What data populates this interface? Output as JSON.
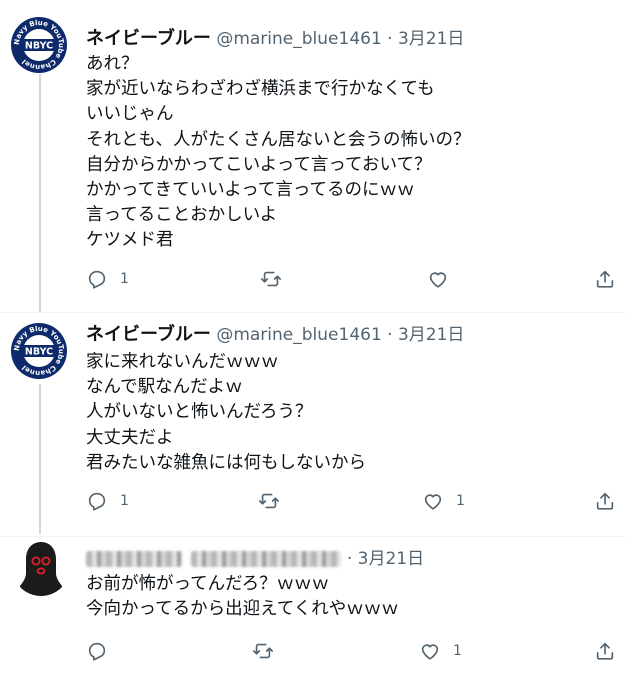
{
  "tweets": [
    {
      "name": "ネイビーブルー",
      "handle": "@marine_blue1461",
      "separator": "·",
      "date": "3月21日",
      "avatar": {
        "ring_text": "Navy Blue YouTube Channel",
        "center_text": "NBYC",
        "ring_color": "#0d2a6b"
      },
      "lines": [
        "あれ？",
        "家が近いならわざわざ横浜まで行かなくても",
        "いいじゃん",
        "それとも、人がたくさん居ないと会うの怖いの？",
        "自分からかかってこいよって言っておいて？",
        "かかってきていいよって言ってるのにｗｗ",
        "言ってることおかしいよ",
        "ケツメド君"
      ],
      "actions": {
        "reply_count": "1",
        "retweet_count": "",
        "like_count": ""
      }
    },
    {
      "name": "ネイビーブルー",
      "handle": "@marine_blue1461",
      "separator": "·",
      "date": "3月21日",
      "avatar": {
        "ring_text": "Navy Blue YouTube Channel",
        "center_text": "NBYC",
        "ring_color": "#0d2a6b"
      },
      "lines": [
        "家に来れないんだｗｗｗ",
        "なんで駅なんだよｗ",
        "人がいないと怖いんだろう？",
        "大丈夫だよ",
        "君みたいな雑魚には何もしないから"
      ],
      "actions": {
        "reply_count": "1",
        "retweet_count": "",
        "like_count": "1"
      }
    },
    {
      "name": "",
      "handle": "",
      "separator": "·",
      "date": "3月21日",
      "lines": [
        "お前が怖がってんだろ？ｗｗｗ",
        "今向かってるから出迎えてくれやｗｗｗ"
      ],
      "actions": {
        "reply_count": "",
        "retweet_count": "",
        "like_count": "1"
      }
    }
  ],
  "icons": {
    "reply": "reply-icon",
    "retweet": "retweet-icon",
    "like": "heart-icon",
    "share": "share-icon"
  },
  "colors": {
    "text": "#0f1419",
    "secondary": "#536471",
    "thread_line": "#cfd9de"
  }
}
